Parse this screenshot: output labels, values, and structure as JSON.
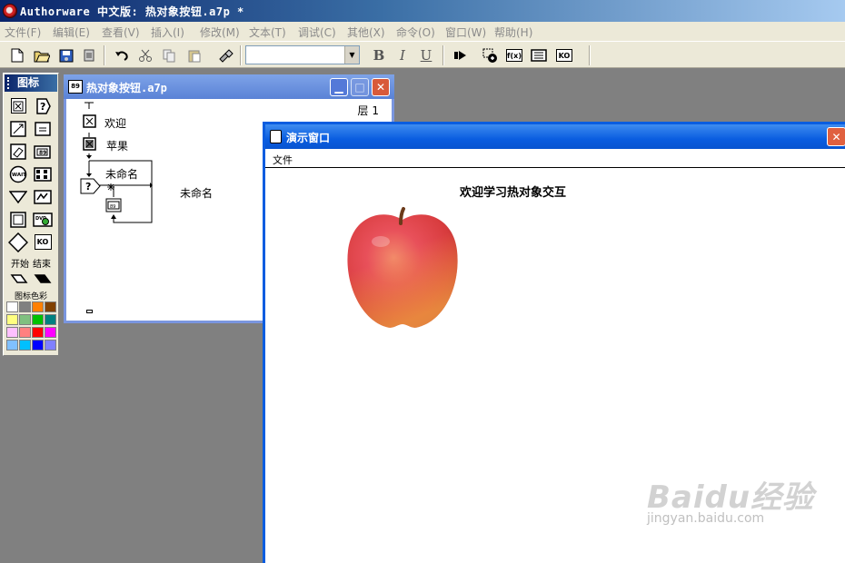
{
  "app": {
    "title": "Authorware 中文版: 热对象按钮.a7p *"
  },
  "menu": [
    "文件(F)",
    "编辑(E)",
    "查看(V)",
    "插入(I)",
    "修改(M)",
    "文本(T)",
    "调试(C)",
    "其他(X)",
    "命令(O)",
    "窗口(W)",
    "帮助(H)"
  ],
  "toolbar": {
    "font_value": "",
    "bold": "B",
    "italic": "I",
    "underline": "U",
    "func_label": "f(x)",
    "ko_label": "KO"
  },
  "icon_palette": {
    "title": "图标",
    "start_label": "开始",
    "end_label": "结束",
    "color_label": "图标色彩",
    "wait_label": "WAIT",
    "dvd_label": "DVD",
    "ko_label": "KO",
    "colors": [
      "#ffffff",
      "#808080",
      "#ff8000",
      "#804000",
      "#ffff80",
      "#80c080",
      "#00c000",
      "#008080",
      "#ffc0ff",
      "#ff8080",
      "#ff0000",
      "#ff00ff",
      "#80c0ff",
      "#00c0ff",
      "#0000ff",
      "#8080ff"
    ]
  },
  "flow_window": {
    "title": "热对象按钮.a7p",
    "layer": "层 1",
    "icons": [
      "欢迎",
      "苹果",
      "未命名",
      "未命名"
    ]
  },
  "presentation": {
    "title": "演示窗口",
    "menu_file": "文件",
    "heading": "欢迎学习热对象交互"
  },
  "watermark": {
    "brand": "Baidu经验",
    "url": "jingyan.baidu.com"
  }
}
